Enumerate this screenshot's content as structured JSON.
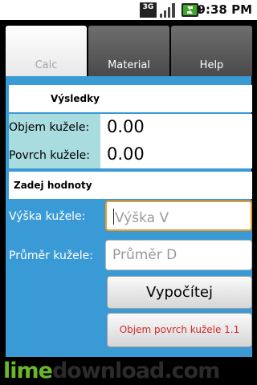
{
  "status_bar": {
    "network_label": "3G",
    "time": "9:38 PM",
    "icons": [
      "3g-icon",
      "signal-icon",
      "battery-icon"
    ]
  },
  "tabs": [
    {
      "label": "Calc",
      "selected": true
    },
    {
      "label": "Material",
      "selected": false
    },
    {
      "label": "Help",
      "selected": false
    }
  ],
  "results": {
    "heading": "Výsledky",
    "rows": [
      {
        "label": "Objem kužele:",
        "value": "0.00"
      },
      {
        "label": "Povrch kužele:",
        "value": "0.00"
      }
    ]
  },
  "inputs": {
    "heading": "Zadej hodnoty",
    "height": {
      "label": "Výška kužele:",
      "placeholder": "Výška V"
    },
    "diameter": {
      "label": "Průměr kužele:",
      "placeholder": "Průměr D"
    }
  },
  "buttons": {
    "calculate": "Vypočítej",
    "about": "Objem povrch kužele 1.1"
  },
  "watermark": {
    "part1": "lime",
    "part2": "download.com"
  },
  "colors": {
    "panel_blue": "#3a9ad6",
    "label_teal": "#a9dcdf",
    "focus_orange": "#f39a1e",
    "about_red": "#d42828",
    "watermark_green": "#6ab82a"
  }
}
